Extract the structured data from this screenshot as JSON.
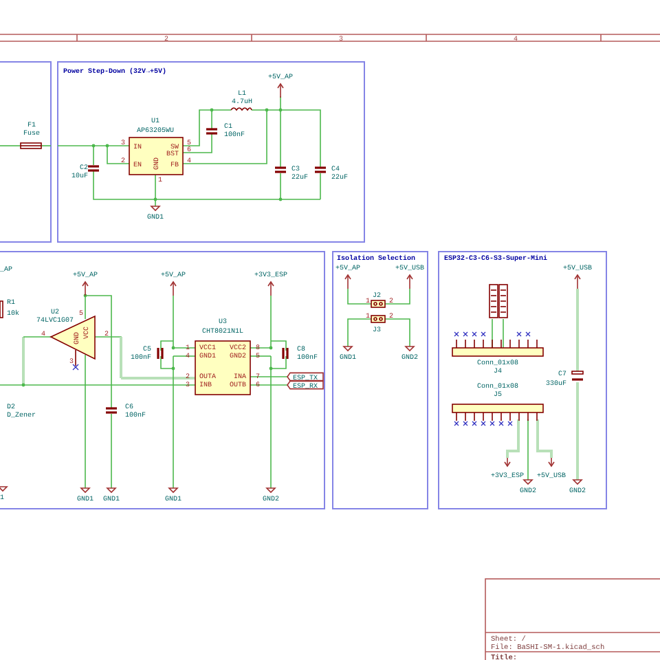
{
  "sheet_frame": {
    "column_numbers": [
      "2",
      "3",
      "4"
    ]
  },
  "input_section": {
    "fuse": {
      "ref": "F1",
      "value": "Fuse"
    }
  },
  "power_step_down": {
    "title": "Power Step-Down (32V→+5V)",
    "regulator": {
      "ref": "U1",
      "value": "AP63205WU",
      "pins": [
        {
          "number": "3",
          "name": "IN"
        },
        {
          "number": "2",
          "name": "EN"
        },
        {
          "number": "1",
          "name": "GND"
        },
        {
          "number": "5",
          "name": "SW"
        },
        {
          "number": "6",
          "name": "BST"
        },
        {
          "number": "4",
          "name": "FB"
        }
      ]
    },
    "capacitors": [
      {
        "ref": "C1",
        "value": "100nF"
      },
      {
        "ref": "C2",
        "value": "10uF"
      },
      {
        "ref": "C3",
        "value": "22uF"
      },
      {
        "ref": "C4",
        "value": "22uF"
      }
    ],
    "inductor": {
      "ref": "L1",
      "value": "4.7uH"
    },
    "power_port": "+5V_AP",
    "ground": "GND1"
  },
  "level_shifter": {
    "power_port_cut": "_AP",
    "resistor": {
      "ref": "R1",
      "value": "10k"
    },
    "buffer": {
      "ref": "U2",
      "value": "74LVC1G07",
      "pins": [
        "4",
        "2",
        "5",
        "3"
      ],
      "pin_names": [
        "GND",
        "VCC"
      ]
    },
    "zener": {
      "ref": "D2",
      "value": "D_Zener"
    },
    "isolator": {
      "ref": "U3",
      "value": "CHT8021N1L",
      "pins": [
        {
          "number": "1",
          "name": "VCC1"
        },
        {
          "number": "4",
          "name": "GND1"
        },
        {
          "number": "2",
          "name": "OUTA"
        },
        {
          "number": "3",
          "name": "INB"
        },
        {
          "number": "8",
          "name": "VCC2"
        },
        {
          "number": "5",
          "name": "GND2"
        },
        {
          "number": "7",
          "name": "INA"
        },
        {
          "number": "6",
          "name": "OUTB"
        }
      ]
    },
    "capacitors": [
      {
        "ref": "C5",
        "value": "100nF"
      },
      {
        "ref": "C6",
        "value": "100nF"
      },
      {
        "ref": "C8",
        "value": "100nF"
      }
    ],
    "power_ports": [
      "+5V_AP",
      "+5V_AP",
      "+3V3_ESP"
    ],
    "grounds": [
      "1",
      "GND1",
      "GND1",
      "GND1",
      "GND2"
    ],
    "net_labels": [
      "ESP_TX",
      "ESP_RX"
    ]
  },
  "isolation_selection": {
    "title": "Isolation Selection",
    "power_ports": [
      "+5V_AP",
      "+5V_USB"
    ],
    "jumpers": [
      {
        "ref": "J2",
        "pins": [
          "1",
          "2"
        ]
      },
      {
        "ref": "J3",
        "pins": [
          "1",
          "2"
        ]
      }
    ],
    "grounds": [
      "GND1",
      "GND2"
    ]
  },
  "esp32_module": {
    "title": "ESP32-C3-C6-S3-Super-Mini",
    "power_ports": [
      "+5V_USB",
      "+3V3_ESP",
      "+5V_USB"
    ],
    "connectors": [
      {
        "ref": "J4",
        "value": "Conn_01x08"
      },
      {
        "ref": "J5",
        "value": "Conn_01x08"
      }
    ],
    "capacitor": {
      "ref": "C7",
      "value": "330uF"
    },
    "grounds": [
      "GND2",
      "GND2"
    ]
  },
  "title_block": {
    "sheet": "Sheet: /",
    "file": "File: BaSHI-SM-1.kicad_sch",
    "title_label": "Title:"
  }
}
